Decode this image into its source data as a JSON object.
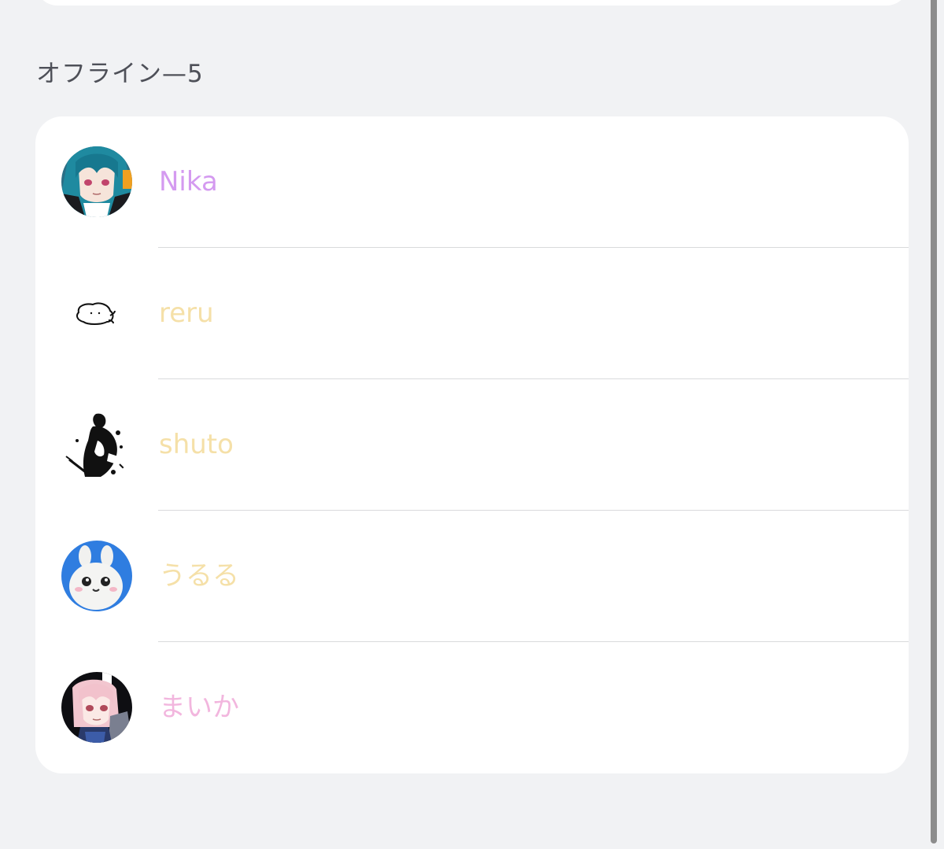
{
  "section": {
    "title": "オフライン—5"
  },
  "members": [
    {
      "name": "Nika",
      "color": "#d49af0",
      "avatar": "anime-girl-teal-hair-avatar"
    },
    {
      "name": "reru",
      "color": "#f5e0a8",
      "avatar": "blob-sketch-avatar"
    },
    {
      "name": "shuto",
      "color": "#f5e0a8",
      "avatar": "samurai-ink-avatar"
    },
    {
      "name": "うるる",
      "color": "#f5e0a8",
      "avatar": "white-bunny-plush-avatar"
    },
    {
      "name": "まいか",
      "color": "#f2b6de",
      "avatar": "anime-girl-pink-hair-avatar"
    }
  ]
}
